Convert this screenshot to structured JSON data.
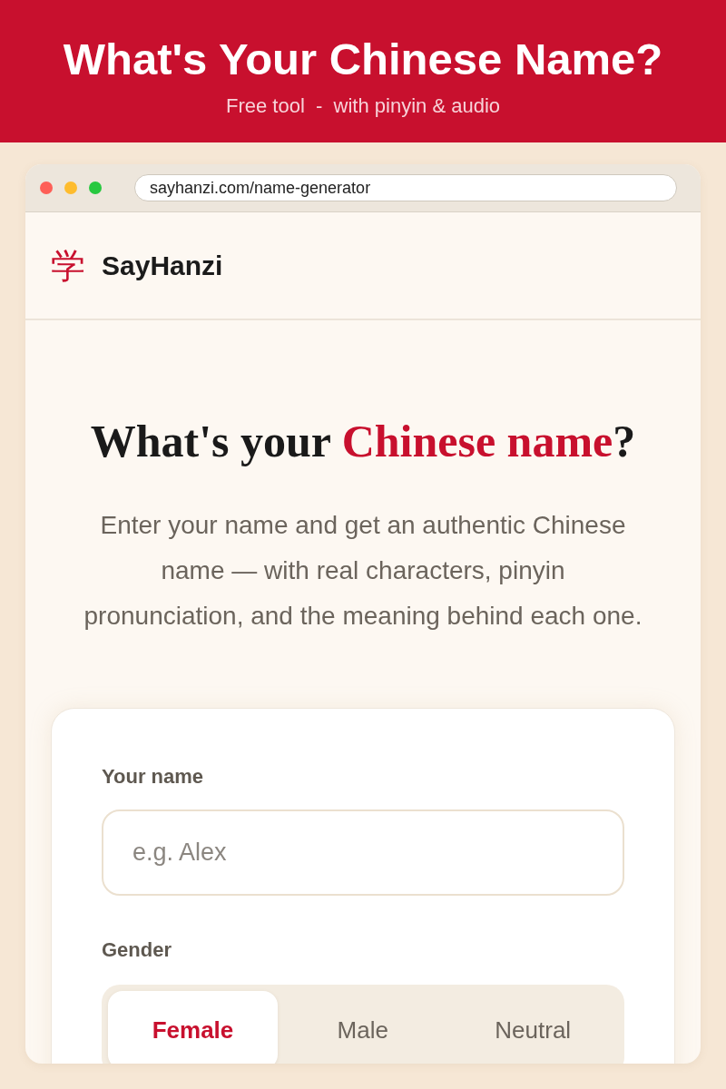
{
  "banner": {
    "title": "What's Your Chinese Name?",
    "subtitle": "Free tool  -  with pinyin & audio"
  },
  "browser": {
    "url": "sayhanzi.com/name-generator"
  },
  "site_header": {
    "logo_mark": "学",
    "brand": "SayHanzi"
  },
  "hero": {
    "heading": [
      {
        "text": "What's your ",
        "accent": false
      },
      {
        "text": "Chinese name",
        "accent": true
      },
      {
        "text": "?",
        "accent": false
      }
    ],
    "description": "Enter your name and get an authentic Chinese\nname — with real characters, pinyin\npronunciation, and the meaning behind each one."
  },
  "form": {
    "name_field": {
      "label": "Your name",
      "placeholder": "e.g. Alex"
    },
    "gender": {
      "label": "Gender",
      "options": [
        {
          "label": "Female",
          "selected": true
        },
        {
          "label": "Male",
          "selected": false
        },
        {
          "label": "Neutral",
          "selected": false
        }
      ]
    }
  }
}
